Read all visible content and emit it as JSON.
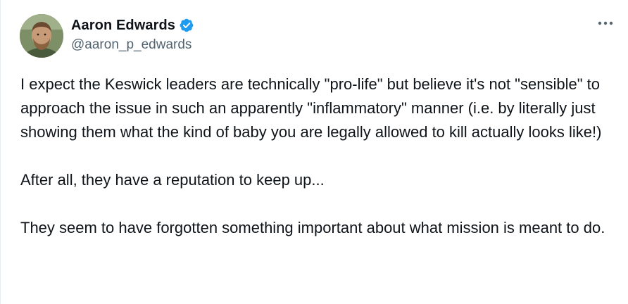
{
  "author": {
    "display_name": "Aaron Edwards",
    "handle": "@aaron_p_edwards",
    "verified": true,
    "verified_color": "#1d9bf0"
  },
  "menu": {
    "icon": "more-horizontal-icon"
  },
  "tweet": {
    "paragraphs": [
      "I expect the Keswick leaders are technically \"pro-life\" but believe it's not \"sensible\" to approach the issue in such an apparently \"inflammatory\" manner (i.e. by literally just showing them what the kind of baby you are legally allowed to kill actually looks like!)",
      "After all, they have a reputation to keep up...",
      "They seem to have forgotten something important about what mission is meant to do."
    ]
  },
  "colors": {
    "text": "#0f1419",
    "secondary_text": "#536471",
    "background": "#ffffff"
  }
}
